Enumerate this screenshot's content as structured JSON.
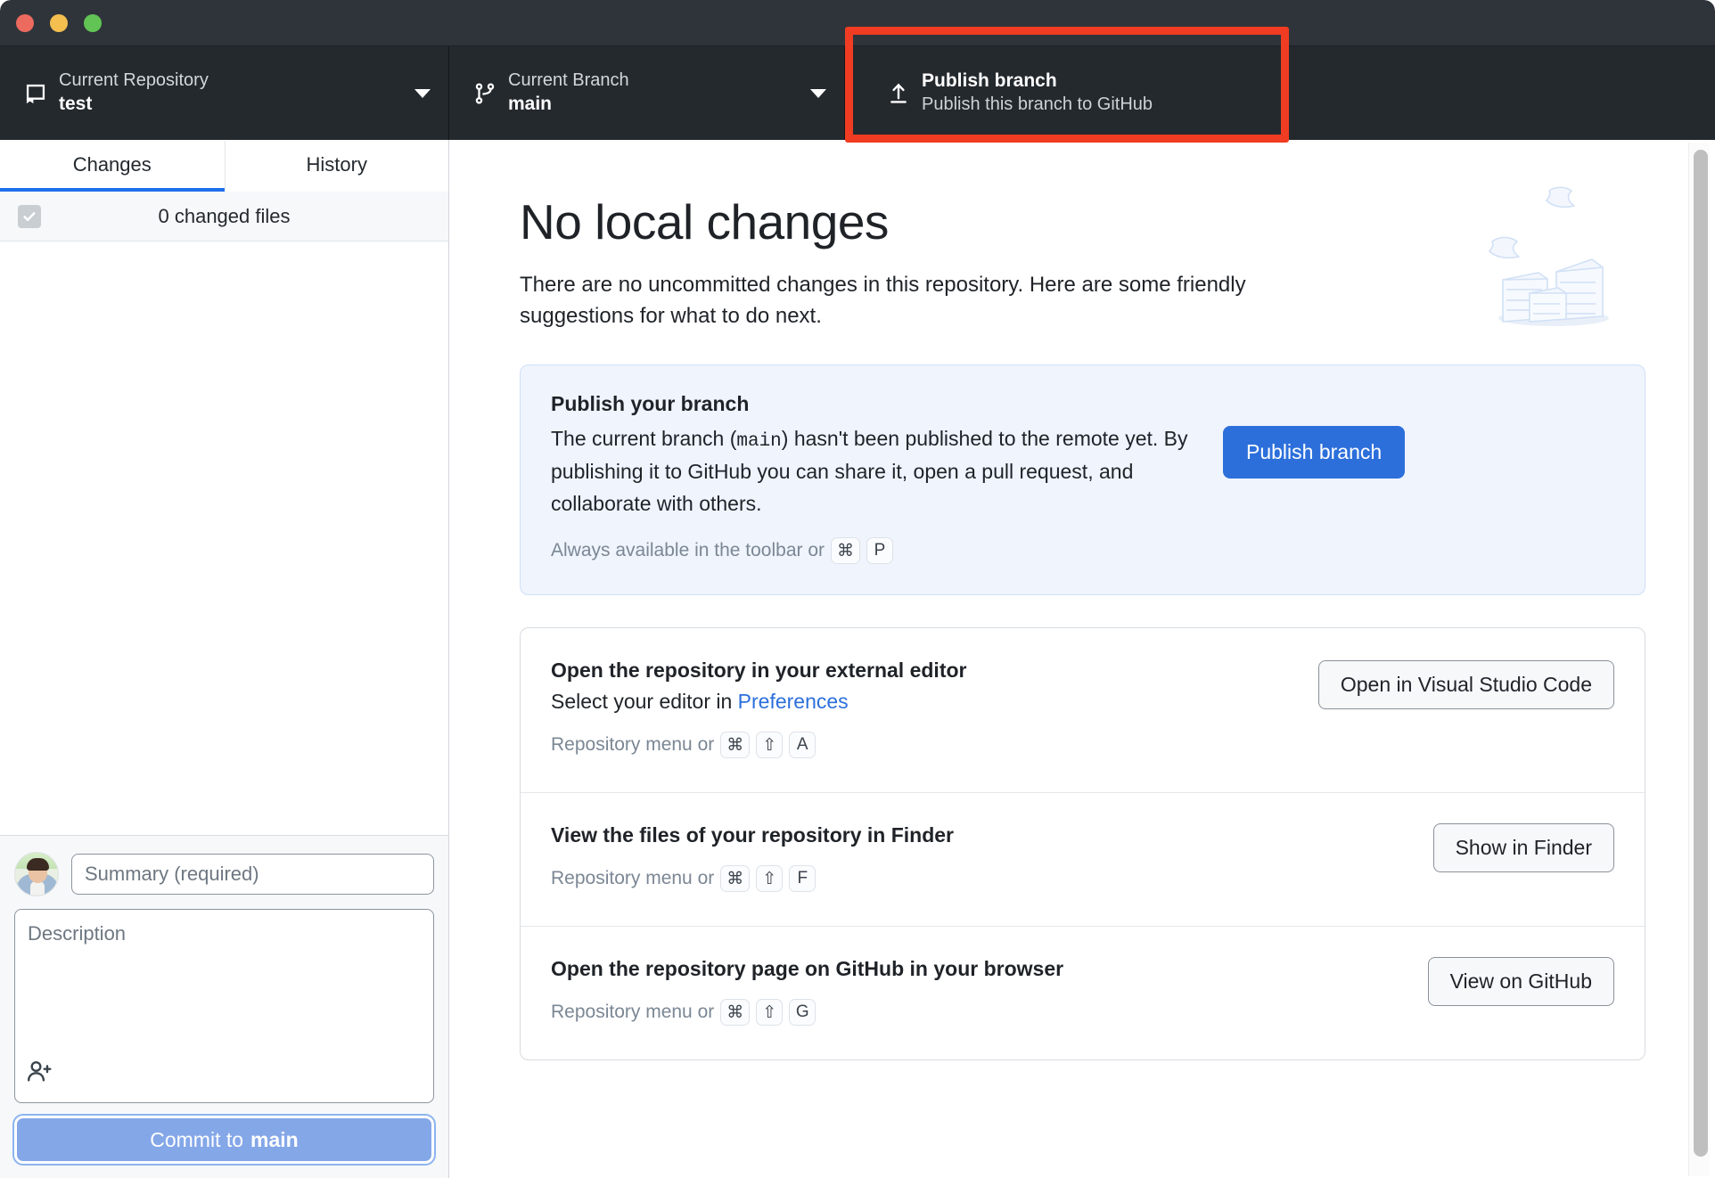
{
  "window": {
    "traffic_lights": [
      "close",
      "minimize",
      "maximize"
    ],
    "colors": {
      "close": "#ed6a5e",
      "minimize": "#f4bf4f",
      "maximize": "#61c454"
    }
  },
  "toolbar": {
    "repository": {
      "icon": "repo-icon",
      "label": "Current Repository",
      "value": "test"
    },
    "branch": {
      "icon": "git-branch-icon",
      "label": "Current Branch",
      "value": "main"
    },
    "publish": {
      "icon": "upload-icon",
      "title": "Publish branch",
      "subtitle": "Publish this branch to GitHub"
    },
    "highlight_color": "#f03c22"
  },
  "sidebar": {
    "tabs": [
      {
        "label": "Changes",
        "active": true
      },
      {
        "label": "History",
        "active": false
      }
    ],
    "changed_files": {
      "label": "0 changed files",
      "checked": true
    },
    "commit": {
      "summary_placeholder": "Summary (required)",
      "summary_value": "",
      "description_placeholder": "Description",
      "description_value": "",
      "add_coauthor_icon": "person-add-icon",
      "button_prefix": "Commit to ",
      "button_branch": "main"
    }
  },
  "main": {
    "title": "No local changes",
    "subtitle": "There are no uncommitted changes in this repository. Here are some friendly suggestions for what to do next.",
    "illustration": "stacked-papers-illustration",
    "publish_card": {
      "title": "Publish your branch",
      "body_part1": "The current branch (",
      "body_branch": "main",
      "body_part2": ") hasn't been published to the remote yet. By publishing it to GitHub you can share it, open a pull request, and collaborate with others.",
      "hint_text": "Always available in the toolbar or",
      "hint_keys": [
        "⌘",
        "P"
      ],
      "button": "Publish branch",
      "accent": "#2c6fdb",
      "background": "#eff4fd"
    },
    "suggestions": [
      {
        "title": "Open the repository in your external editor",
        "sub_prefix": "Select your editor in ",
        "sub_link": "Preferences",
        "hint_text": "Repository menu or",
        "hint_keys": [
          "⌘",
          "⇧",
          "A"
        ],
        "button": "Open in Visual Studio Code"
      },
      {
        "title": "View the files of your repository in Finder",
        "sub_prefix": "",
        "sub_link": "",
        "hint_text": "Repository menu or",
        "hint_keys": [
          "⌘",
          "⇧",
          "F"
        ],
        "button": "Show in Finder"
      },
      {
        "title": "Open the repository page on GitHub in your browser",
        "sub_prefix": "",
        "sub_link": "",
        "hint_text": "Repository menu or",
        "hint_keys": [
          "⌘",
          "⇧",
          "G"
        ],
        "button": "View on GitHub"
      }
    ]
  }
}
